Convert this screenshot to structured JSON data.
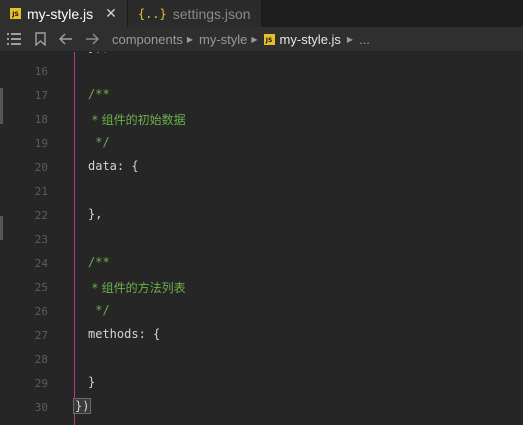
{
  "tabs": [
    {
      "label": "my-style.js",
      "type": "js",
      "active": true,
      "badge": "JS"
    },
    {
      "label": "settings.json",
      "type": "json",
      "active": false,
      "badge": "{..}"
    }
  ],
  "breadcrumb": {
    "items": [
      "components",
      "my-style"
    ],
    "current": "my-style.js",
    "more": "..."
  },
  "editor": {
    "lines": [
      {
        "num": "16",
        "text": "",
        "kind": "code"
      },
      {
        "num": "17",
        "text": "/**",
        "kind": "comment"
      },
      {
        "num": "18",
        "text": " * 组件的初始数据",
        "kind": "comment"
      },
      {
        "num": "19",
        "text": " */",
        "kind": "comment"
      },
      {
        "num": "20",
        "text": "data: {",
        "kind": "code"
      },
      {
        "num": "21",
        "text": "",
        "kind": "code"
      },
      {
        "num": "22",
        "text": "},",
        "kind": "code"
      },
      {
        "num": "23",
        "text": "",
        "kind": "code"
      },
      {
        "num": "24",
        "text": "/**",
        "kind": "comment"
      },
      {
        "num": "25",
        "text": " * 组件的方法列表",
        "kind": "comment"
      },
      {
        "num": "26",
        "text": " */",
        "kind": "comment"
      },
      {
        "num": "27",
        "text": "methods: {",
        "kind": "code"
      },
      {
        "num": "28",
        "text": "",
        "kind": "code"
      },
      {
        "num": "29",
        "text": "}",
        "kind": "code"
      },
      {
        "num": "30",
        "text": "})",
        "kind": "code"
      }
    ],
    "top_fragment": "}),"
  },
  "colors": {
    "comment": "#6ab04c",
    "guide": "#b03b8a",
    "js_badge": "#e8bf2b"
  }
}
